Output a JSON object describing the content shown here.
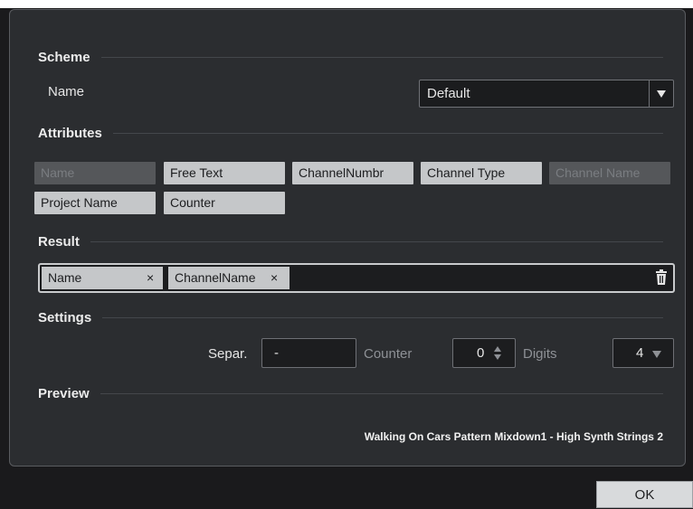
{
  "sections": {
    "scheme": "Scheme",
    "attributes": "Attributes",
    "result": "Result",
    "settings": "Settings",
    "preview": "Preview"
  },
  "scheme": {
    "name_label": "Name",
    "selected": "Default"
  },
  "attributes": [
    {
      "label": "Name",
      "enabled": false
    },
    {
      "label": "Free Text",
      "enabled": true
    },
    {
      "label": "ChannelNumbr",
      "enabled": true
    },
    {
      "label": "Channel Type",
      "enabled": true
    },
    {
      "label": "Channel Name",
      "enabled": false
    },
    {
      "label": "Project Name",
      "enabled": true
    },
    {
      "label": "Counter",
      "enabled": true
    }
  ],
  "result_tokens": [
    {
      "label": "Name",
      "remove": "×"
    },
    {
      "label": "ChannelName",
      "remove": "×"
    }
  ],
  "settings": {
    "separator_label": "Separ.",
    "separator_value": "-",
    "counter_label": "Counter",
    "counter_value": "0",
    "digits_label": "Digits",
    "digits_value": "4"
  },
  "preview_text": "Walking On Cars Pattern Mixdown1 - High Synth Strings 2",
  "ok_label": "OK",
  "icons": {
    "dropdown": "triangle-down-icon",
    "trash": "trash-icon",
    "stepper": "up-down-icon"
  }
}
